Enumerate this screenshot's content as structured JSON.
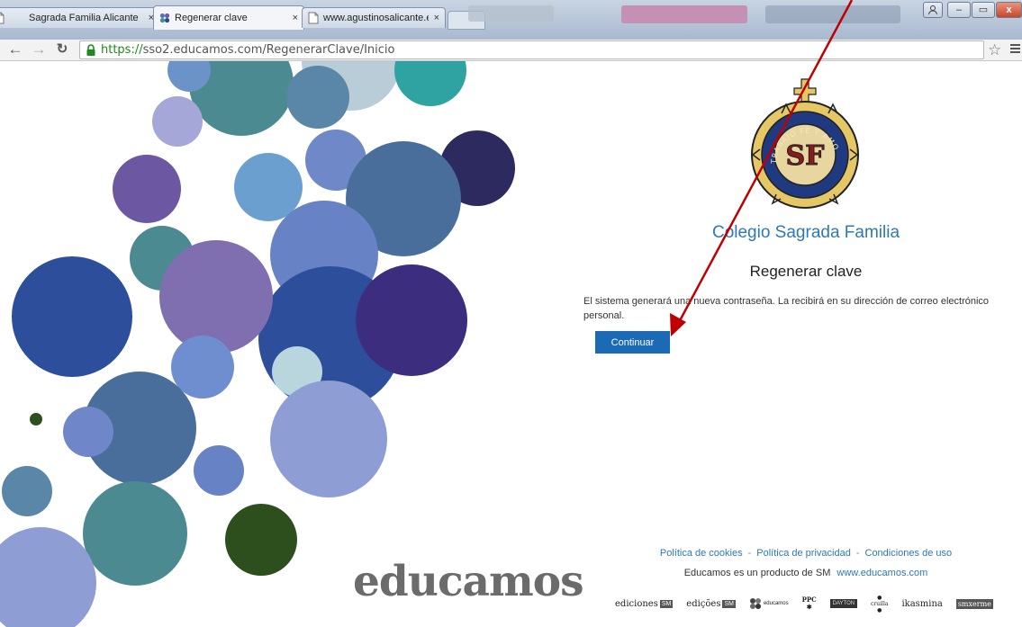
{
  "browser": {
    "tabs": [
      {
        "title": "Sagrada Familia Alicante",
        "close": "×",
        "active": false,
        "icon": "document-icon"
      },
      {
        "title": "Regenerar clave",
        "close": "×",
        "active": true,
        "icon": "educamos-favicon-icon"
      },
      {
        "title": "www.agustinosalicante.es",
        "close": "×",
        "active": false,
        "icon": "document-icon"
      }
    ],
    "url_scheme": "https://",
    "url_rest": "sso2.educamos.com/RegenerarClave/Inicio",
    "window_controls": {
      "minimize": "–",
      "restore": "▭",
      "close": "x"
    }
  },
  "page": {
    "school_name": "Colegio Sagrada Familia",
    "crest_text": "TRABAJO FE Y AMOR",
    "crest_monogram": "SF",
    "title": "Regenerar clave",
    "description": "El sistema generará una nueva contraseña. La recibirá en su dirección de correo electrónico personal.",
    "continue_label": "Continuar",
    "brand_logo": "educamos"
  },
  "footer": {
    "links": [
      "Política de cookies",
      "Política de privacidad",
      "Condiciones de uso"
    ],
    "separator": "-",
    "product_text": "Educamos es un producto de SM",
    "product_link": "www.educamos.com",
    "brands": [
      "ediciones",
      "edições",
      "educamos",
      "PPC",
      "DAYTON",
      "cruilla",
      "ikasmina",
      "smxerme"
    ],
    "sm_tag": "SM"
  },
  "colors": {
    "accent_blue": "#1b6ab6",
    "link_blue": "#2e78b7",
    "annotation_red": "#c00000"
  }
}
